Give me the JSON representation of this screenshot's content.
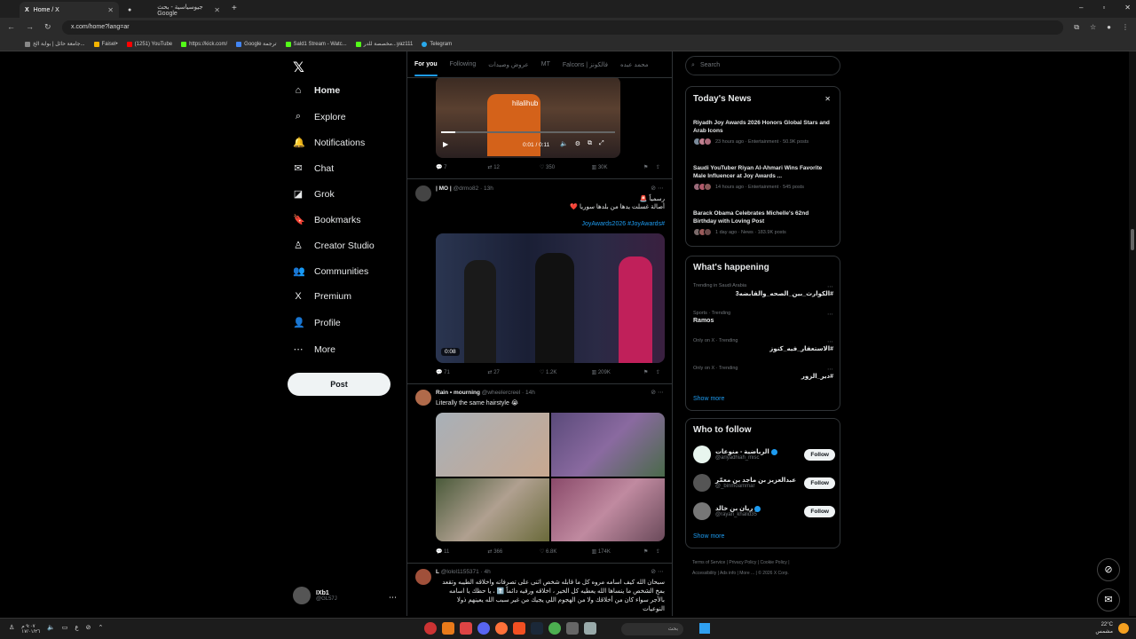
{
  "browser": {
    "tabs": [
      {
        "title": "Home / X",
        "active": true
      },
      {
        "title": "جيوسياسية - بحث Google",
        "active": false
      }
    ],
    "url": "x.com/home?lang=ar",
    "bookmarks": [
      "جامعة حائل | بوابة الخ...",
      "Faisel•",
      "(1251) YouTube",
      "https://kick.com/",
      "Google ترجمة",
      "Sald1 Stream - Watc...",
      "مخصصة للدر...yaz111",
      "Telegram"
    ]
  },
  "nav": {
    "items": [
      {
        "label": "Home",
        "icon": "⌂"
      },
      {
        "label": "Explore",
        "icon": "⌕"
      },
      {
        "label": "Notifications",
        "icon": "🔔"
      },
      {
        "label": "Chat",
        "icon": "✉"
      },
      {
        "label": "Grok",
        "icon": "◪"
      },
      {
        "label": "Bookmarks",
        "icon": "🔖"
      },
      {
        "label": "Creator Studio",
        "icon": "♙"
      },
      {
        "label": "Communities",
        "icon": "👥"
      },
      {
        "label": "Premium",
        "icon": "X"
      },
      {
        "label": "Profile",
        "icon": "👤"
      },
      {
        "label": "More",
        "icon": "⋯"
      }
    ],
    "post_label": "Post",
    "account_name": "IXb1",
    "account_handle": "@GL57J"
  },
  "feed": {
    "tabs": [
      "For you",
      "Following",
      "عروض وصيدات",
      "MT",
      "Falcons | فالكونز",
      "محمد عبده"
    ],
    "posts": [
      {
        "video_overlay": "hilalihub",
        "video_time": "0:01 / 0:11",
        "replies": "7",
        "reposts": "12",
        "likes": "350",
        "views": "30K"
      },
      {
        "name": "| MO |",
        "handle": "@drmo82 · 13h",
        "text1": "رسمياً 🚨",
        "text2": "أصالة غسلت يدها من بلدها سوريا ❤️",
        "hashtags": "#JoyAwards2026 #JoyAwards",
        "video_badge": "0:08",
        "replies": "71",
        "reposts": "27",
        "likes": "1.2K",
        "views": "209K"
      },
      {
        "name": "Rain • mourning",
        "handle": "@wheelercreel · 14h",
        "text": "Literally the same hairstyle 😭",
        "replies": "11",
        "reposts": "366",
        "likes": "6.8K",
        "views": "174K"
      },
      {
        "name": "L",
        "handle": "@lolol1155371 · 4h",
        "text": "سبحان الله كيف اسامه مروه كل ما قابله شخص اثنى على تصرفاته واخلاقه الطيبه وتقعد بمخ الشخص ما ينساها الله يعطيه كل الخير ، اخلاقه ورقيه دائماً ⬆️ ، يا حظك يا اسامه بالأجر سواء كان من أخلاقك ولا من الهجوم اللي يجيك من غير سبب الله يعينهم ذولا النوعيات"
      }
    ]
  },
  "right": {
    "search_placeholder": "Search",
    "news_title": "Today's News",
    "news": [
      {
        "title": "Riyadh Joy Awards 2026 Honors Global Stars and Arab Icons",
        "meta": "23 hours ago · Entertainment · 50.9K posts"
      },
      {
        "title": "Saudi YouTuber Riyan Al-Ahmari Wins Favorite Male Influencer at Joy Awards ...",
        "meta": "14 hours ago · Entertainment · 545 posts"
      },
      {
        "title": "Barack Obama Celebrates Michelle's 62nd Birthday with Loving Post",
        "meta": "1 day ago · News · 183.9K posts"
      }
    ],
    "happening_title": "What's happening",
    "trends": [
      {
        "context": "Trending in Saudi Arabia",
        "name": "#الكوارث_بين_الصحه_والقابضه3"
      },
      {
        "context": "Sports · Trending",
        "name": "Ramos"
      },
      {
        "context": "Only on X · Trending",
        "name": "#الاستعفار_فيه_كنوز"
      },
      {
        "context": "Only on X · Trending",
        "name": "#دير_الزور"
      }
    ],
    "show_more": "Show more",
    "wtf_title": "Who to follow",
    "follow": [
      {
        "name": "الرياضية - منوعات",
        "handle": "@ariyadhiah_misc",
        "verified": true
      },
      {
        "name": "عبدالعزيز بن ماجد بن معمّر",
        "handle": "@_binmoammar",
        "verified": false
      },
      {
        "name": "ريان بن خالد",
        "handle": "@rayan_khalid35",
        "verified": true
      }
    ],
    "follow_label": "Follow",
    "footer": [
      "Terms of Service",
      "Privacy Policy",
      "Cookie Policy",
      "Accessibility",
      "Ads info",
      "More ...",
      "© 2026 X Corp."
    ]
  },
  "taskbar": {
    "search_text": "بحث",
    "weather": "22°C",
    "weather_sub": "مشمس",
    "time": "٩:٠٧ م",
    "date": "١٧/٠١/٢٦"
  }
}
